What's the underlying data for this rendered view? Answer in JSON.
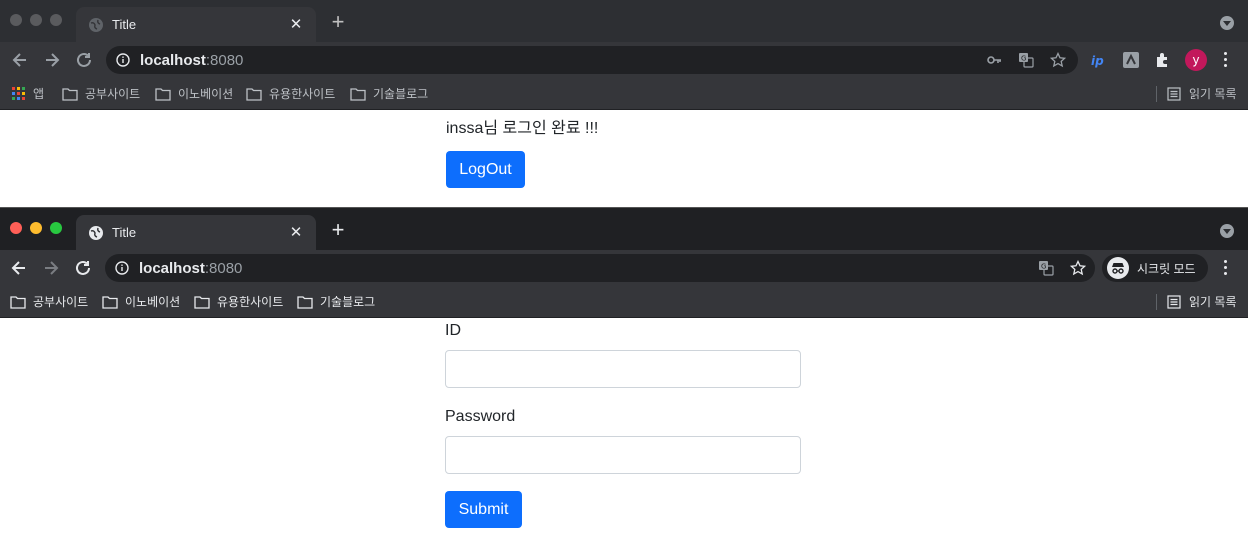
{
  "window1": {
    "tab_title": "Title",
    "url_host": "localhost",
    "url_port": ":8080",
    "bookmarks": [
      "앱",
      "공부사이트",
      "이노베이션",
      "유용한사이트",
      "기술블로그"
    ],
    "reading_list": "읽기 목록",
    "profile_initial": "y",
    "welcome_text": "inssa님 로그인 완료 !!!",
    "logout_label": "LogOut",
    "colors": {
      "primary": "#0d6efd",
      "profile": "#c2185b"
    }
  },
  "window2": {
    "tab_title": "Title",
    "url_host": "localhost",
    "url_port": ":8080",
    "bookmarks": [
      "공부사이트",
      "이노베이션",
      "유용한사이트",
      "기술블로그"
    ],
    "reading_list": "읽기 목록",
    "incognito_label": "시크릿 모드",
    "form": {
      "id_label": "ID",
      "id_value": "",
      "password_label": "Password",
      "password_value": "",
      "submit_label": "Submit"
    }
  }
}
